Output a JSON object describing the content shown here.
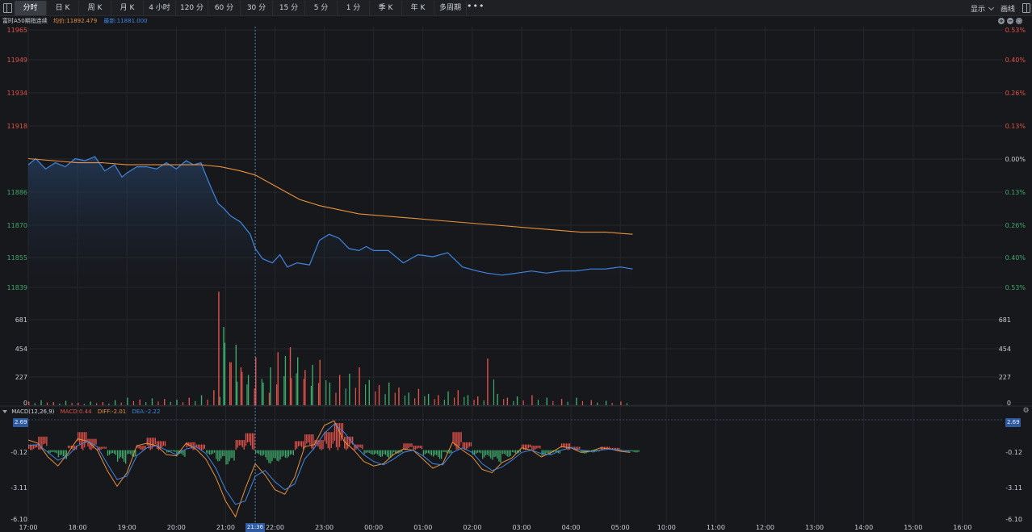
{
  "toolbar": {
    "tabs": [
      {
        "label": "分时",
        "active": true
      },
      {
        "label": "日 K",
        "active": false
      },
      {
        "label": "周 K",
        "active": false
      },
      {
        "label": "月 K",
        "active": false
      },
      {
        "label": "4 小时",
        "active": false
      },
      {
        "label": "120 分",
        "active": false
      },
      {
        "label": "60 分",
        "active": false
      },
      {
        "label": "30 分",
        "active": false
      },
      {
        "label": "15 分",
        "active": false
      },
      {
        "label": "5 分",
        "active": false
      },
      {
        "label": "1 分",
        "active": false
      },
      {
        "label": "季 K",
        "active": false
      },
      {
        "label": "年 K",
        "active": false
      },
      {
        "label": "多周期",
        "active": false
      }
    ],
    "more_label": "•••",
    "display_label": "显示",
    "draw_label": "画线"
  },
  "info": {
    "symbol": "富时A50期指连续",
    "avg_text": "均价:11892.479",
    "last_text": "最新:11881.000"
  },
  "macd": {
    "name": "MACD(12,26,9)",
    "macd_text": "MACD:0.44",
    "diff_text": "DIFF:-2.01",
    "dea_text": "DEA:-2.22",
    "badge_value": "2.69"
  },
  "crosshair": {
    "time_label": "21:36"
  },
  "colors": {
    "price": "#3f86e0",
    "avg": "#e8913c",
    "up": "#e0524a",
    "down": "#3fa86a",
    "grid": "#25272d"
  },
  "chart_data": [
    {
      "type": "line",
      "name_hint": "price",
      "y_left_ticks": [
        "11965",
        "11949",
        "11934",
        "11918",
        "11886",
        "11870",
        "11855",
        "11839"
      ],
      "y_right_ticks": [
        "0.53%",
        "0.40%",
        "0.26%",
        "0.13%",
        "0.00%",
        "0.13%",
        "0.26%",
        "0.40%",
        "0.53%"
      ],
      "ylim": [
        11839,
        11965
      ],
      "prev_close": 11902,
      "x_tick_labels": [
        "17:00",
        "18:00",
        "19:00",
        "20:00",
        "21:00",
        "22:00",
        "23:00",
        "00:00",
        "01:00",
        "02:00",
        "03:00",
        "04:00",
        "05:00",
        "10:00",
        "11:00",
        "12:00",
        "13:00",
        "14:00",
        "15:00",
        "16:00"
      ],
      "series": [
        {
          "key": "price",
          "x_hours": [
            0,
            0.15,
            0.35,
            0.55,
            0.75,
            0.95,
            1.15,
            1.35,
            1.55,
            1.75,
            1.9,
            2.0,
            2.2,
            2.4,
            2.6,
            2.8,
            3.0,
            3.2,
            3.35,
            3.5,
            3.7,
            3.85,
            3.95,
            4.1,
            4.3,
            4.5,
            4.6,
            4.75,
            4.95,
            5.1,
            5.25,
            5.45,
            5.7,
            5.9,
            6.1,
            6.3,
            6.5,
            6.7,
            6.85,
            7.0,
            7.3,
            7.6,
            7.9,
            8.2,
            8.5,
            8.8,
            9.1,
            9.3,
            9.6,
            9.9,
            10.2,
            10.5,
            10.8,
            11.1,
            11.4,
            11.7,
            12.0,
            12.25
          ],
          "values": [
            11899,
            11902,
            11897,
            11900,
            11898,
            11902,
            11901,
            11903,
            11896,
            11899,
            11893,
            11895,
            11898,
            11898,
            11897,
            11900,
            11897,
            11901,
            11899,
            11900,
            11888,
            11880,
            11878,
            11874,
            11871,
            11865,
            11858,
            11853,
            11851,
            11855,
            11849,
            11851,
            11850,
            11862,
            11865,
            11863,
            11858,
            11857,
            11859,
            11857,
            11857,
            11851,
            11855,
            11854,
            11856,
            11849,
            11847,
            11846,
            11845,
            11846,
            11847,
            11846,
            11847,
            11847,
            11848,
            11848,
            11849,
            11848
          ]
        },
        {
          "key": "avg",
          "x_hours": [
            0,
            0.5,
            1.0,
            1.5,
            2.0,
            2.5,
            3.0,
            3.5,
            3.9,
            4.3,
            4.6,
            4.9,
            5.2,
            5.5,
            5.9,
            6.3,
            6.7,
            7.2,
            7.7,
            8.2,
            8.7,
            9.2,
            9.7,
            10.2,
            10.7,
            11.2,
            11.7,
            12.25
          ],
          "values": [
            11902,
            11901,
            11900,
            11900,
            11899,
            11899,
            11899,
            11899,
            11898,
            11896,
            11894,
            11890,
            11886,
            11882,
            11879,
            11877,
            11875,
            11874,
            11873,
            11872,
            11871,
            11870,
            11869,
            11868,
            11867,
            11866,
            11866,
            11865
          ]
        }
      ]
    },
    {
      "type": "bar",
      "name_hint": "volume",
      "y_ticks": [
        "681",
        "454",
        "227",
        "0"
      ],
      "ylim": [
        0,
        908
      ],
      "x_hours": [
        0,
        0.25,
        0.5,
        0.75,
        1.0,
        1.25,
        1.5,
        1.75,
        2.0,
        2.25,
        2.5,
        2.75,
        3.0,
        3.25,
        3.5,
        3.75,
        3.85,
        3.95,
        4.1,
        4.2,
        4.3,
        4.45,
        4.6,
        4.75,
        4.9,
        5.05,
        5.2,
        5.3,
        5.45,
        5.6,
        5.75,
        5.9,
        6.1,
        6.3,
        6.5,
        6.7,
        6.9,
        7.1,
        7.3,
        7.5,
        7.7,
        7.9,
        8.1,
        8.3,
        8.5,
        8.7,
        8.9,
        9.1,
        9.3,
        9.5,
        9.7,
        9.9,
        10.2,
        10.5,
        10.8,
        11.1,
        11.4,
        11.7,
        12.0
      ],
      "values": [
        30,
        40,
        25,
        35,
        20,
        30,
        25,
        40,
        60,
        45,
        55,
        50,
        45,
        60,
        80,
        120,
        900,
        620,
        340,
        480,
        300,
        240,
        380,
        180,
        300,
        420,
        390,
        460,
        380,
        280,
        320,
        360,
        180,
        240,
        250,
        300,
        200,
        160,
        180,
        140,
        100,
        130,
        90,
        80,
        110,
        120,
        80,
        70,
        370,
        90,
        60,
        70,
        80,
        60,
        50,
        60,
        40,
        35,
        30
      ],
      "up": [
        1,
        0,
        1,
        0,
        1,
        0,
        1,
        0,
        0,
        1,
        0,
        1,
        0,
        1,
        0,
        1,
        1,
        0,
        1,
        0,
        1,
        0,
        1,
        0,
        0,
        1,
        0,
        1,
        0,
        1,
        0,
        1,
        0,
        1,
        0,
        1,
        0,
        1,
        0,
        1,
        0,
        1,
        0,
        1,
        0,
        1,
        0,
        1,
        1,
        0,
        1,
        0,
        1,
        0,
        1,
        0,
        1,
        0,
        1
      ]
    },
    {
      "type": "bar",
      "name_hint": "macd",
      "y_ticks": [
        "2.69",
        "-0.12",
        "-3.11",
        "-6.10"
      ],
      "ylim": [
        -6.1,
        2.69
      ],
      "x_hours": [
        0,
        0.2,
        0.4,
        0.6,
        0.8,
        1.0,
        1.2,
        1.4,
        1.6,
        1.8,
        2.0,
        2.2,
        2.4,
        2.6,
        2.8,
        3.0,
        3.2,
        3.4,
        3.6,
        3.8,
        4.0,
        4.2,
        4.4,
        4.6,
        4.8,
        5.0,
        5.2,
        5.4,
        5.6,
        5.8,
        6.0,
        6.2,
        6.4,
        6.6,
        6.8,
        7.0,
        7.2,
        7.4,
        7.6,
        7.8,
        8.0,
        8.2,
        8.4,
        8.6,
        8.8,
        9.0,
        9.2,
        9.4,
        9.6,
        9.8,
        10.0,
        10.2,
        10.4,
        10.6,
        10.8,
        11.0,
        11.2,
        11.4,
        11.6,
        11.8,
        12.0,
        12.2
      ],
      "hist": [
        0.5,
        1.2,
        -0.3,
        -0.8,
        0.4,
        1.6,
        1.0,
        0.3,
        -0.5,
        -1.2,
        -0.6,
        0.4,
        1.1,
        0.8,
        -0.2,
        -0.6,
        0.7,
        0.5,
        -0.4,
        -1.0,
        -1.3,
        0.9,
        1.5,
        -0.5,
        -1.2,
        -1.0,
        -0.7,
        0.8,
        1.4,
        0.9,
        1.6,
        2.4,
        1.2,
        0.5,
        -0.4,
        -0.6,
        -0.7,
        -0.3,
        0.6,
        0.4,
        -0.5,
        -0.8,
        -0.3,
        1.6,
        0.7,
        -0.4,
        -0.8,
        -1.1,
        -0.6,
        -0.3,
        0.5,
        0.4,
        -0.5,
        -0.3,
        0.6,
        0.3,
        -0.3,
        -0.2,
        0.3,
        0.2,
        -0.1,
        -0.2
      ],
      "diff": [
        0.9,
        0.6,
        -0.6,
        -1.4,
        -0.3,
        1.0,
        0.8,
        0.0,
        -1.8,
        -3.2,
        -2.0,
        0.4,
        0.6,
        0.4,
        -0.4,
        -0.5,
        0.6,
        0.1,
        -0.8,
        -2.4,
        -4.5,
        -5.9,
        -3.4,
        -1.2,
        -2.2,
        -3.5,
        -3.9,
        -2.4,
        0.3,
        0.5,
        2.2,
        2.6,
        0.8,
        0.0,
        -1.0,
        -1.4,
        -1.2,
        -0.4,
        0.1,
        0.0,
        -0.8,
        -1.6,
        -1.2,
        0.7,
        0.0,
        -0.6,
        -1.7,
        -2.0,
        -1.1,
        -0.7,
        0.2,
        0.0,
        -0.6,
        -0.2,
        0.3,
        0.2,
        -0.2,
        -0.1,
        0.2,
        0.1,
        -0.1,
        -0.2
      ],
      "dea": [
        0.4,
        0.5,
        -0.2,
        -0.9,
        -0.5,
        0.4,
        0.8,
        0.3,
        -1.2,
        -2.6,
        -2.3,
        -0.5,
        0.2,
        0.4,
        0.0,
        -0.4,
        0.1,
        0.3,
        -0.3,
        -1.6,
        -3.5,
        -4.8,
        -4.5,
        -2.3,
        -1.8,
        -2.8,
        -3.5,
        -3.0,
        -0.8,
        0.2,
        1.5,
        2.3,
        1.6,
        0.5,
        -0.4,
        -1.0,
        -1.3,
        -0.8,
        -0.2,
        0.0,
        -0.5,
        -1.2,
        -1.3,
        -0.2,
        0.2,
        -0.2,
        -1.2,
        -1.8,
        -1.5,
        -0.9,
        -0.2,
        0.0,
        -0.3,
        -0.4,
        0.0,
        0.2,
        0.0,
        -0.1,
        0.0,
        0.1,
        0.0,
        -0.1
      ]
    }
  ]
}
